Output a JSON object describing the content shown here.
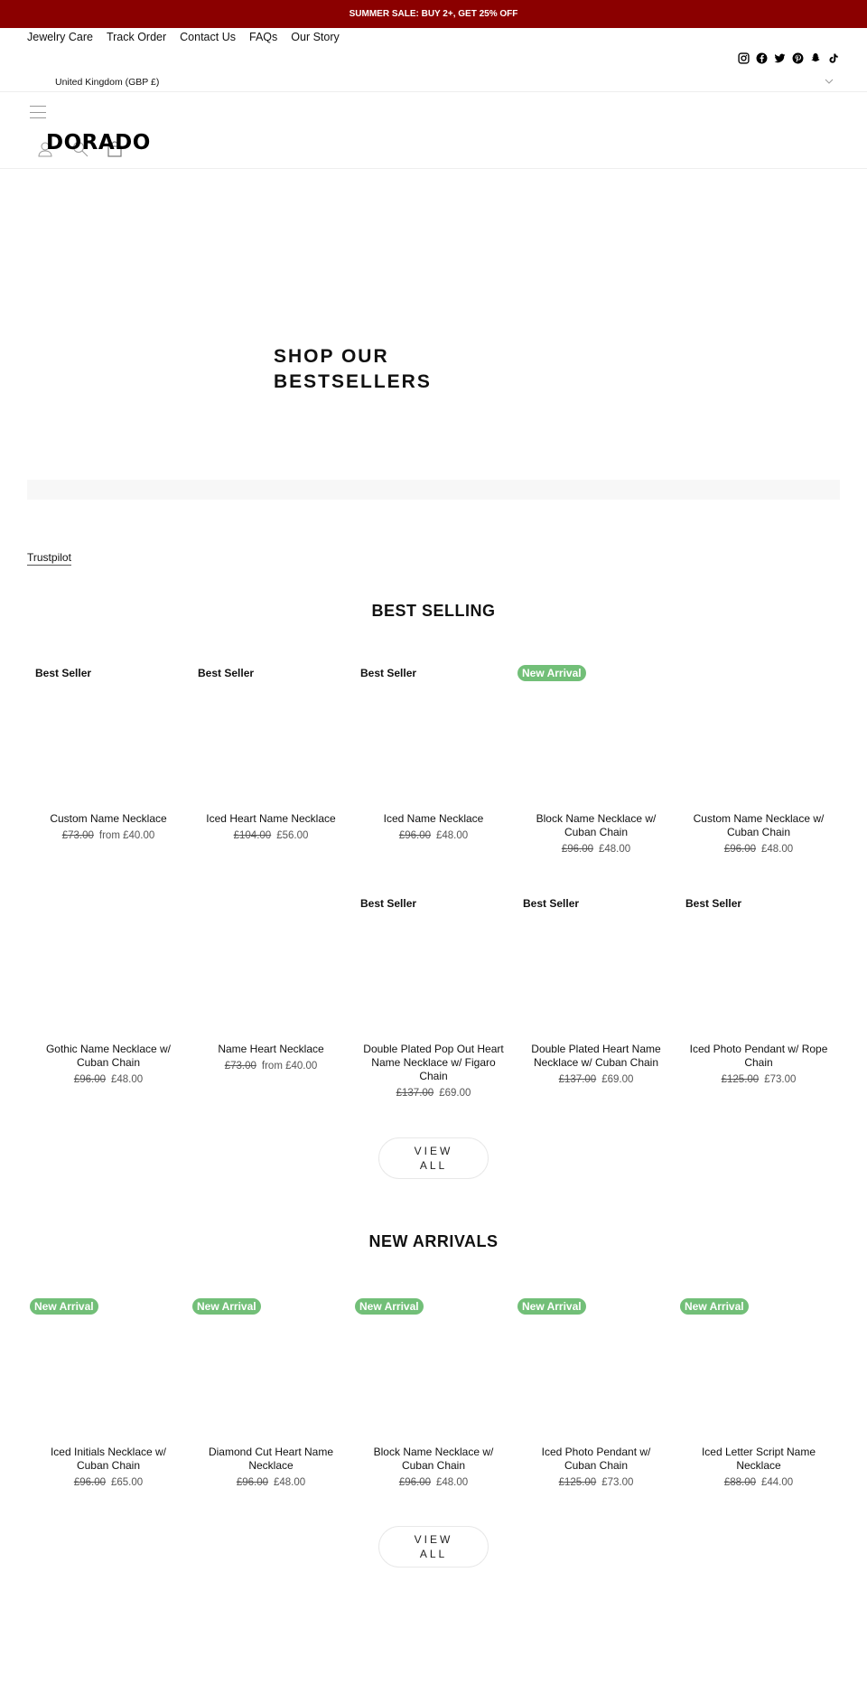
{
  "announcement": "SUMMER SALE: BUY 2+, GET 25% OFF",
  "colors": {
    "announcement_bg": "#8b0000",
    "new_arrival_badge": "#72bf78"
  },
  "util_nav": [
    "Jewelry Care",
    "Track Order",
    "Contact Us",
    "FAQs",
    "Our Story"
  ],
  "social_icons": [
    "instagram-icon",
    "facebook-icon",
    "twitter-icon",
    "pinterest-icon",
    "snapchat-icon",
    "tiktok-icon"
  ],
  "country_selector": {
    "value": "United Kingdom (GBP £)"
  },
  "header": {
    "logo": "DORADO"
  },
  "hero": {
    "title": "SHOP OUR BESTSELLERS"
  },
  "trustpilot_link": "Trustpilot",
  "best_selling": {
    "title": "BEST SELLING",
    "view_all": "VIEW ALL",
    "products": [
      {
        "badge": "Best Seller",
        "badge_type": "text",
        "title": "Custom Name Necklace",
        "compare_price": "£73.00",
        "price": "from £40.00"
      },
      {
        "badge": "Best Seller",
        "badge_type": "text",
        "title": "Iced Heart Name Necklace",
        "compare_price": "£104.00",
        "price": "£56.00"
      },
      {
        "badge": "Best Seller",
        "badge_type": "text",
        "title": "Iced Name Necklace",
        "compare_price": "£96.00",
        "price": "£48.00"
      },
      {
        "badge": "New Arrival",
        "badge_type": "new",
        "title": "Block Name Necklace w/ Cuban Chain",
        "compare_price": "£96.00",
        "price": "£48.00"
      },
      {
        "badge": "",
        "badge_type": "none",
        "title": "Custom Name Necklace w/ Cuban Chain",
        "compare_price": "£96.00",
        "price": "£48.00"
      },
      {
        "badge": "",
        "badge_type": "none",
        "title": "Gothic Name Necklace w/ Cuban Chain",
        "compare_price": "£96.00",
        "price": "£48.00"
      },
      {
        "badge": "",
        "badge_type": "none",
        "title": "Name Heart Necklace",
        "compare_price": "£73.00",
        "price": "from £40.00"
      },
      {
        "badge": "Best Seller",
        "badge_type": "text",
        "title": "Double Plated Pop Out Heart Name Necklace w/ Figaro Chain",
        "compare_price": "£137.00",
        "price": "£69.00"
      },
      {
        "badge": "Best Seller",
        "badge_type": "text",
        "title": "Double Plated Heart Name Necklace w/ Cuban Chain",
        "compare_price": "£137.00",
        "price": "£69.00"
      },
      {
        "badge": "Best Seller",
        "badge_type": "text",
        "title": "Iced Photo Pendant w/ Rope Chain",
        "compare_price": "£125.00",
        "price": "£73.00"
      }
    ]
  },
  "new_arrivals": {
    "title": "NEW ARRIVALS",
    "view_all": "VIEW ALL",
    "products": [
      {
        "badge": "New Arrival",
        "badge_type": "new",
        "title": "Iced Initials Necklace w/ Cuban Chain",
        "compare_price": "£96.00",
        "price": "£65.00"
      },
      {
        "badge": "New Arrival",
        "badge_type": "new",
        "title": "Diamond Cut Heart Name Necklace",
        "compare_price": "£96.00",
        "price": "£48.00"
      },
      {
        "badge": "New Arrival",
        "badge_type": "new",
        "title": "Block Name Necklace w/ Cuban Chain",
        "compare_price": "£96.00",
        "price": "£48.00"
      },
      {
        "badge": "New Arrival",
        "badge_type": "new",
        "title": "Iced Photo Pendant w/ Cuban Chain",
        "compare_price": "£125.00",
        "price": "£73.00"
      },
      {
        "badge": "New Arrival",
        "badge_type": "new",
        "title": "Iced Letter Script Name Necklace",
        "compare_price": "£88.00",
        "price": "£44.00"
      }
    ]
  }
}
